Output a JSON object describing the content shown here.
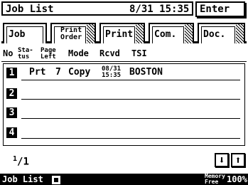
{
  "header": {
    "title": "Job List",
    "date": "8/31",
    "time": "15:35",
    "enter_label": "Enter"
  },
  "tabs": [
    {
      "label": "Job",
      "active": true
    },
    {
      "label_line1": "Print",
      "label_line2": "Order",
      "active": false
    },
    {
      "label": "Print",
      "active": false
    },
    {
      "label": "Com.",
      "active": false
    },
    {
      "label": "Doc.",
      "active": false
    }
  ],
  "columns": {
    "no": "No",
    "status_line1": "Sta-",
    "status_line2": "tus",
    "page_line1": "Page",
    "page_line2": "Left",
    "mode": "Mode",
    "rcvd": "Rcvd",
    "tsi": "TSI"
  },
  "rows": [
    {
      "num": "1",
      "status": "Prt",
      "page_left": "7",
      "mode": "Copy",
      "rcvd_date": "08/31",
      "rcvd_time": "15:35",
      "tsi": "BOSTON"
    },
    {
      "num": "2"
    },
    {
      "num": "3"
    },
    {
      "num": "4"
    }
  ],
  "footer": {
    "page_current": "1",
    "page_sep": "/",
    "page_total": "1",
    "down_icon": "arrow-down-icon",
    "up_icon": "arrow-up-icon",
    "down_glyph": "⬇",
    "up_glyph": "⬆"
  },
  "status_bar": {
    "mode": "Job List",
    "memory_line1": "Memory",
    "memory_line2": "Free",
    "memory_value": "100%"
  }
}
